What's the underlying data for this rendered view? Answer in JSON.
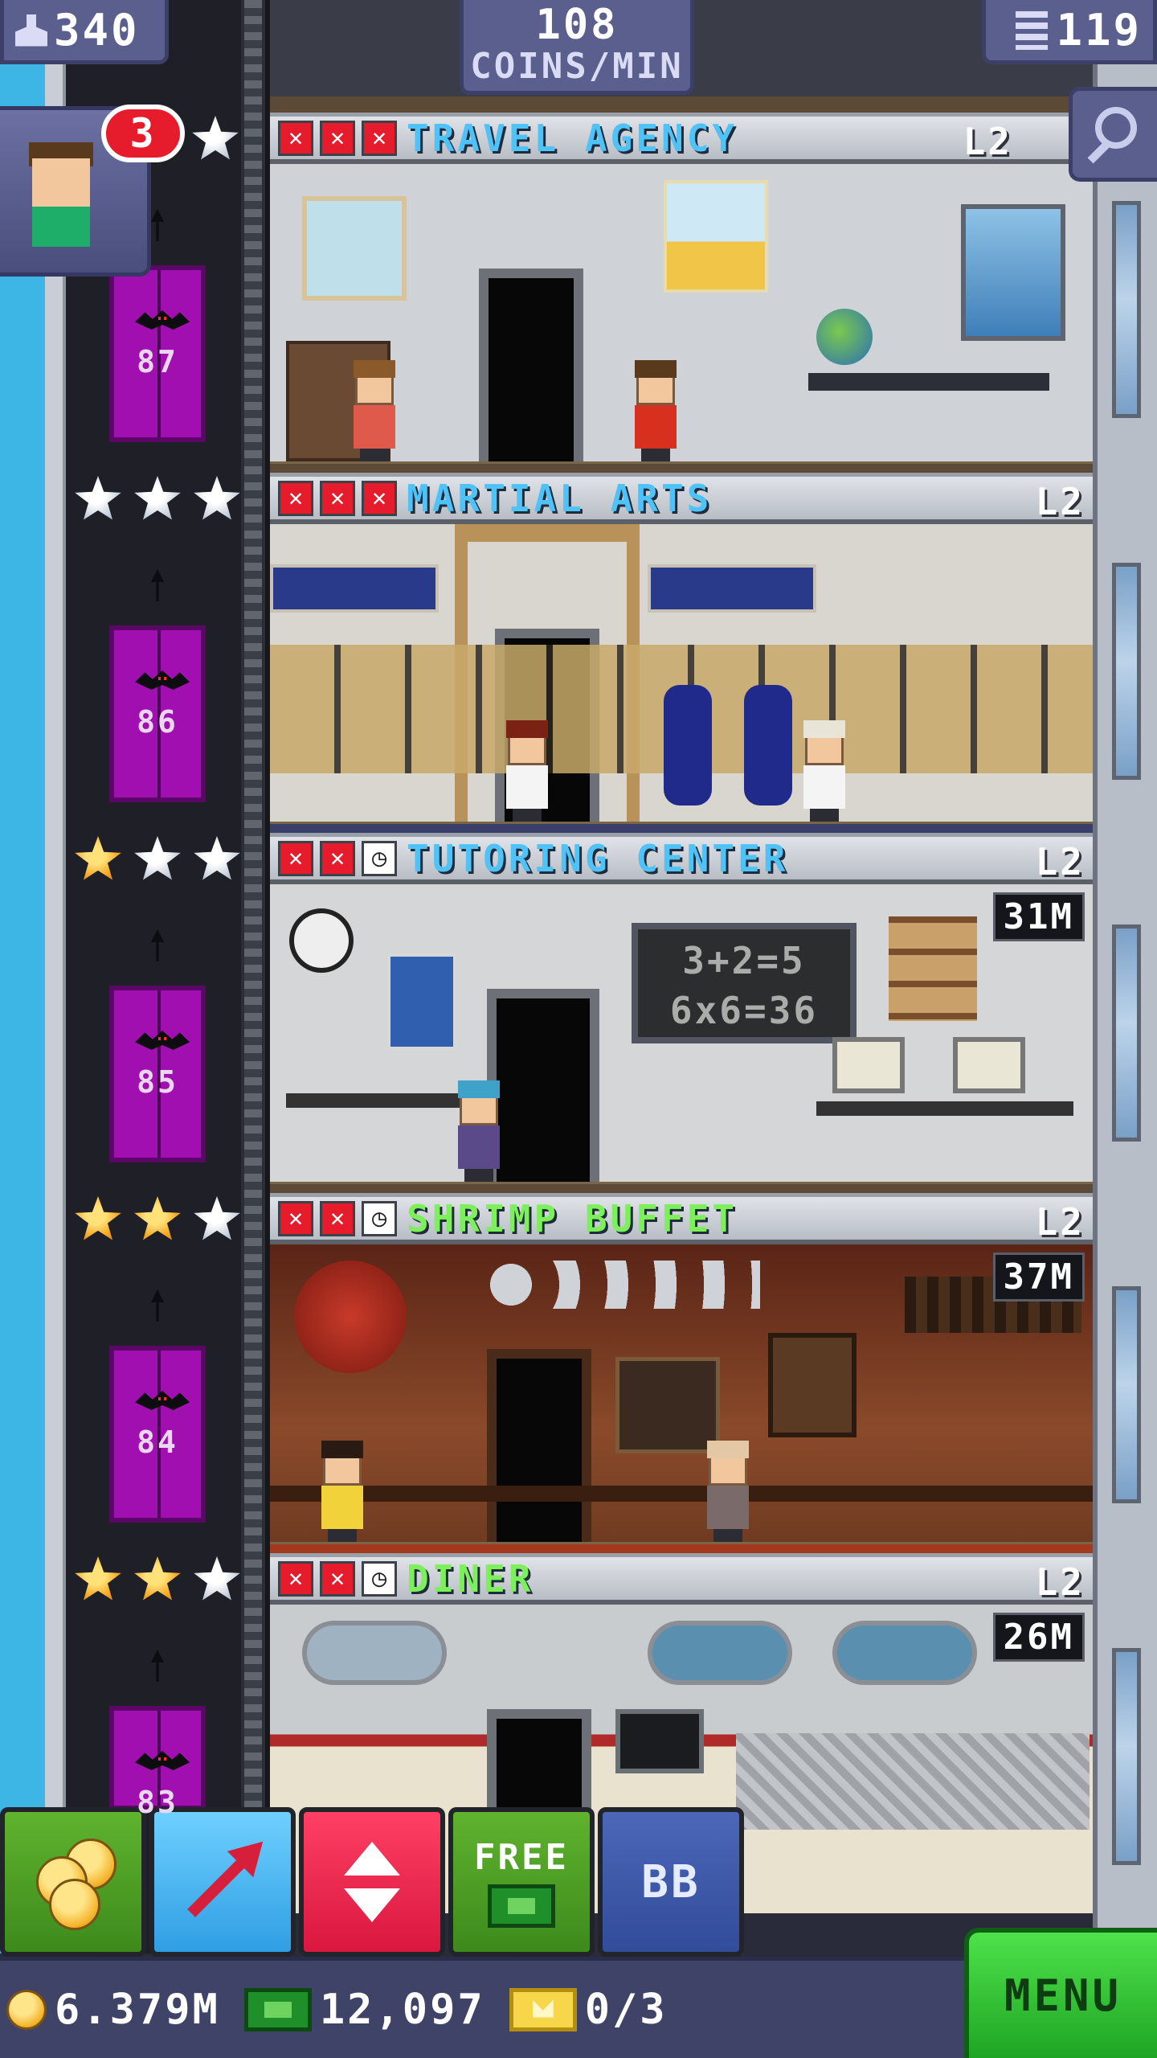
{
  "hud": {
    "population": "340",
    "coin_rate_value": "108",
    "coin_rate_unit": "COINS/MIN",
    "floor_count": "119"
  },
  "missions": {
    "badge_count": "3"
  },
  "floors": [
    {
      "name": "TRAVEL AGENCY",
      "level": "L2",
      "elevator_number": "87",
      "name_color": "#4fc3f7",
      "status": [
        "x",
        "x",
        "x"
      ],
      "stars": [
        "silver"
      ],
      "timer": ""
    },
    {
      "name": "MARTIAL ARTS",
      "level": "L2",
      "elevator_number": "86",
      "name_color": "#4fc3f7",
      "status": [
        "x",
        "x",
        "x"
      ],
      "stars": [
        "silver",
        "silver",
        "silver"
      ],
      "timer": ""
    },
    {
      "name": "TUTORING CENTER",
      "level": "L2",
      "elevator_number": "85",
      "name_color": "#4fc3f7",
      "status": [
        "x",
        "x",
        "clock"
      ],
      "stars": [
        "gold",
        "silver",
        "silver"
      ],
      "timer": "31M"
    },
    {
      "name": "SHRIMP BUFFET",
      "level": "L2",
      "elevator_number": "84",
      "name_color": "#7cf05a",
      "status": [
        "x",
        "x",
        "clock"
      ],
      "stars": [
        "gold",
        "gold",
        "silver"
      ],
      "timer": "37M"
    },
    {
      "name": "DINER",
      "level": "L2",
      "elevator_number": "83",
      "name_color": "#7cf05a",
      "status": [
        "x",
        "x",
        "clock"
      ],
      "stars": [
        "gold",
        "gold",
        "silver"
      ],
      "timer": "26M"
    }
  ],
  "chalkboard": {
    "line1": "3+2=5",
    "line2": "6x6=36"
  },
  "action_bar": {
    "free_label": "FREE",
    "bb_label": "BB"
  },
  "resources": {
    "coins": "6.379M",
    "bux": "12,097",
    "tickets": "0/3"
  },
  "menu_label": "MENU",
  "icons": {
    "population": "person-icon",
    "floors": "building-icon",
    "zoom": "magnifier-icon",
    "coins": "coin-icon",
    "bux": "bux-icon",
    "tickets": "golden-ticket-icon",
    "clock": "clock-icon"
  },
  "colors": {
    "hud_panel": "#5a5f8e",
    "elevator": "#a20fb0",
    "x_status": "#e61c2d",
    "menu": "#2fc02f"
  }
}
